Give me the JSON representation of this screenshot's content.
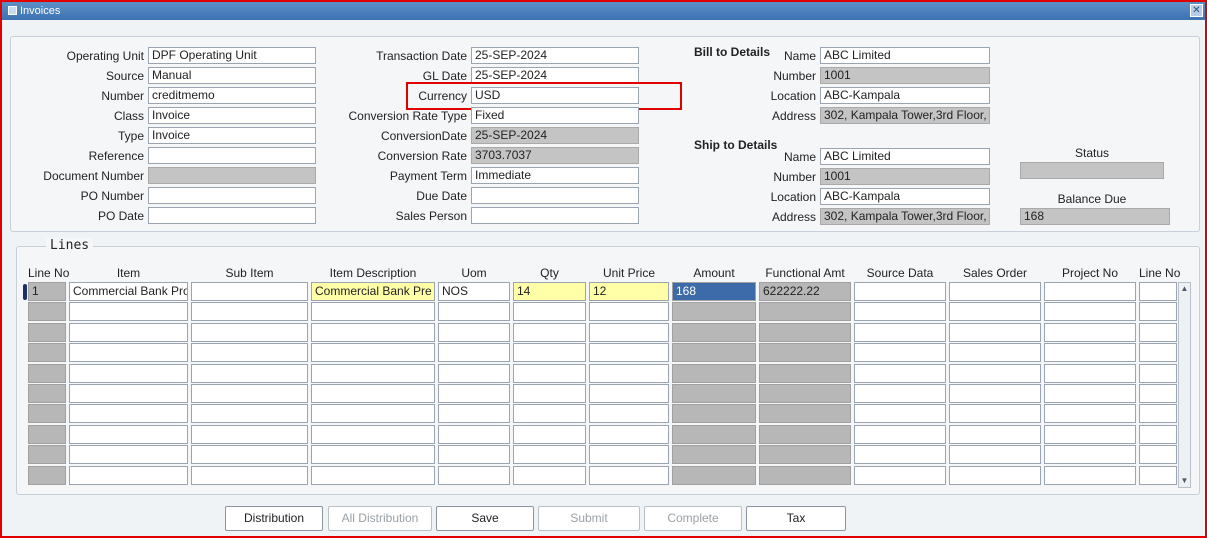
{
  "window": {
    "title": "Invoices",
    "close_glyph": "✕"
  },
  "header": {
    "operating_unit": {
      "label": "Operating Unit",
      "value": "DPF Operating Unit"
    },
    "source": {
      "label": "Source",
      "value": "Manual"
    },
    "number": {
      "label": "Number",
      "value": "creditmemo"
    },
    "class": {
      "label": "Class",
      "value": "Invoice"
    },
    "type": {
      "label": "Type",
      "value": "Invoice"
    },
    "reference": {
      "label": "Reference",
      "value": ""
    },
    "document_number": {
      "label": "Document Number",
      "value": ""
    },
    "po_number": {
      "label": "PO Number",
      "value": ""
    },
    "po_date": {
      "label": "PO Date",
      "value": ""
    },
    "transaction_date": {
      "label": "Transaction Date",
      "value": "25-SEP-2024"
    },
    "gl_date": {
      "label": "GL Date",
      "value": "25-SEP-2024"
    },
    "currency": {
      "label": "Currency",
      "value": "USD"
    },
    "conversion_rate_type": {
      "label": "Conversion Rate Type",
      "value": "Fixed"
    },
    "conversion_date": {
      "label": "ConversionDate",
      "value": "25-SEP-2024"
    },
    "conversion_rate": {
      "label": "Conversion Rate",
      "value": "3703.7037"
    },
    "payment_term": {
      "label": "Payment Term",
      "value": "Immediate"
    },
    "due_date": {
      "label": "Due Date",
      "value": ""
    },
    "sales_person": {
      "label": "Sales Person",
      "value": ""
    }
  },
  "bill_to": {
    "heading": "Bill to Details",
    "name": {
      "label": "Name",
      "value": "ABC Limited"
    },
    "number": {
      "label": "Number",
      "value": "1001"
    },
    "location": {
      "label": "Location",
      "value": "ABC-Kampala"
    },
    "address": {
      "label": "Address",
      "value": "302, Kampala Tower,3rd Floor,"
    }
  },
  "ship_to": {
    "heading": "Ship to Details",
    "name": {
      "label": "Name",
      "value": "ABC Limited"
    },
    "number": {
      "label": "Number",
      "value": "1001"
    },
    "location": {
      "label": "Location",
      "value": "ABC-Kampala"
    },
    "address": {
      "label": "Address",
      "value": "302, Kampala Tower,3rd Floor,"
    }
  },
  "status": {
    "label": "Status",
    "value": ""
  },
  "balance_due": {
    "label": "Balance Due",
    "value": "168"
  },
  "lines": {
    "caption": "Lines",
    "columns": [
      "Line No",
      "Item",
      "Sub Item",
      "Item Description",
      "Uom",
      "Qty",
      "Unit Price",
      "Amount",
      "Functional Amt",
      "Source Data",
      "Sales Order",
      "Project No",
      "Line No"
    ],
    "rows": [
      [
        "1",
        "Commercial Bank Pro",
        "",
        "Commercial Bank Pre",
        "NOS",
        "14",
        "12",
        "168",
        "622222.22",
        "",
        "",
        "",
        ""
      ],
      [
        "",
        "",
        "",
        "",
        "",
        "",
        "",
        "",
        "",
        "",
        "",
        "",
        ""
      ],
      [
        "",
        "",
        "",
        "",
        "",
        "",
        "",
        "",
        "",
        "",
        "",
        "",
        ""
      ],
      [
        "",
        "",
        "",
        "",
        "",
        "",
        "",
        "",
        "",
        "",
        "",
        "",
        ""
      ],
      [
        "",
        "",
        "",
        "",
        "",
        "",
        "",
        "",
        "",
        "",
        "",
        "",
        ""
      ],
      [
        "",
        "",
        "",
        "",
        "",
        "",
        "",
        "",
        "",
        "",
        "",
        "",
        ""
      ],
      [
        "",
        "",
        "",
        "",
        "",
        "",
        "",
        "",
        "",
        "",
        "",
        "",
        ""
      ],
      [
        "",
        "",
        "",
        "",
        "",
        "",
        "",
        "",
        "",
        "",
        "",
        "",
        ""
      ],
      [
        "",
        "",
        "",
        "",
        "",
        "",
        "",
        "",
        "",
        "",
        "",
        "",
        ""
      ],
      [
        "",
        "",
        "",
        "",
        "",
        "",
        "",
        "",
        "",
        "",
        "",
        "",
        ""
      ]
    ]
  },
  "buttons": {
    "distribution": "Distribution",
    "all_distribution": "All Distribution",
    "save": "Save",
    "submit": "Submit",
    "complete": "Complete",
    "tax": "Tax"
  }
}
